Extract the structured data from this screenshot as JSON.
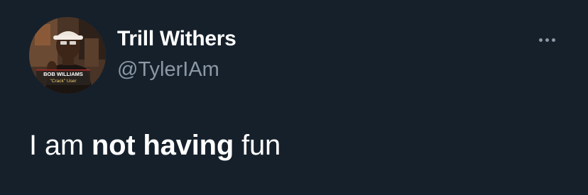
{
  "author": {
    "display_name": "Trill Withers",
    "handle": "@TylerIAm",
    "avatar_caption_line1": "BOB WILLIAMS",
    "avatar_caption_line2": "\"Crack\" User"
  },
  "menu": {
    "icon": "more-horizontal-icon"
  },
  "tweet": {
    "text_before": "I am ",
    "text_bold": "not having",
    "text_after": " fun"
  },
  "colors": {
    "background": "#15202b",
    "primary_text": "#ffffff",
    "secondary_text": "#8b98a5"
  }
}
